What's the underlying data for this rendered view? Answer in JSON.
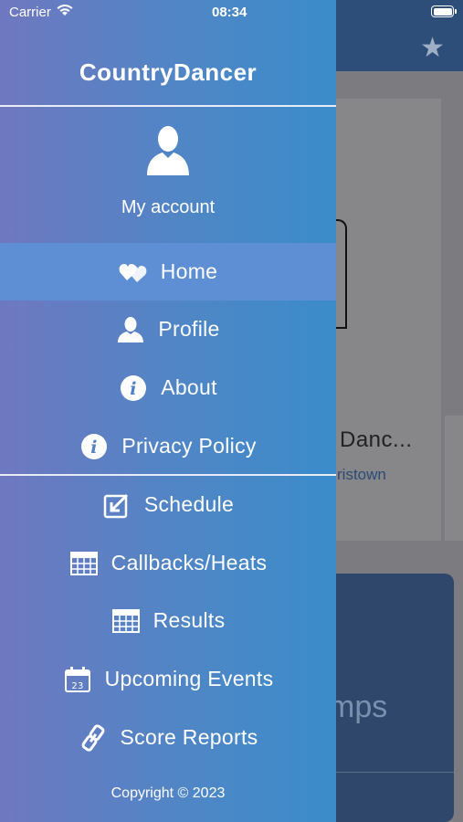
{
  "status_bar": {
    "carrier": "Carrier",
    "time": "08:34",
    "wifi_icon": "wifi-icon",
    "battery_icon": "battery-icon"
  },
  "background_app": {
    "card_title": "Danc...",
    "card_subtitle": "ristown",
    "bigcard_text": "mps",
    "star_icon": "star-icon"
  },
  "drawer": {
    "app_title": "CountryDancer",
    "account_label": "My account",
    "avatar_icon": "person-icon",
    "menu": [
      {
        "label": "Home",
        "icon": "hearts-icon",
        "active": true
      },
      {
        "label": "Profile",
        "icon": "person-icon",
        "active": false
      },
      {
        "label": "About",
        "icon": "info-icon",
        "active": false
      },
      {
        "label": "Privacy Policy",
        "icon": "info-icon",
        "active": false
      },
      {
        "label": "Schedule",
        "icon": "edit-box-icon",
        "active": false
      },
      {
        "label": "Callbacks/Heats",
        "icon": "table-icon",
        "active": false
      },
      {
        "label": "Results",
        "icon": "table-icon",
        "active": false
      },
      {
        "label": "Upcoming Events",
        "icon": "calendar-icon",
        "active": false
      },
      {
        "label": "Score Reports",
        "icon": "link-icon",
        "active": false
      }
    ],
    "calendar_day": "23",
    "copyright": "Copyright © 2023"
  },
  "colors": {
    "drawer_gradient_start": "#6f78c0",
    "drawer_gradient_end": "#3b8cca",
    "active_item": "#5e8ed4",
    "header_bg": "#2e4e7a"
  }
}
